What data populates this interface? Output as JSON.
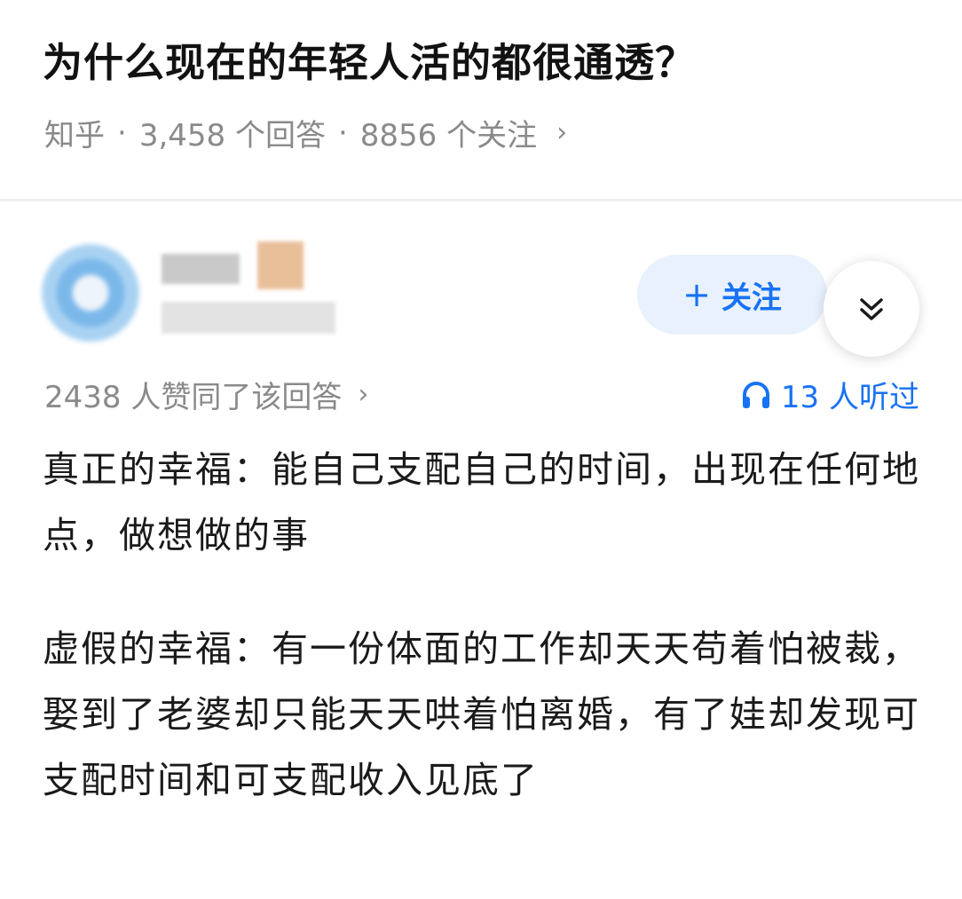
{
  "question": {
    "title": "为什么现在的年轻人活的都很通透？",
    "source": "知乎",
    "answers_count": "3,458 个回答",
    "followers_count": "8856 个关注"
  },
  "author": {
    "follow_label": "关注"
  },
  "answer": {
    "votes_text": "2438 人赞同了该回答",
    "listen_text": "13 人听过",
    "paragraphs": [
      "真正的幸福：能自己支配自己的时间，出现在任何地点，做想做的事",
      "虚假的幸福：有一份体面的工作却天天苟着怕被裁，娶到了老婆却只能天天哄着怕离婚，有了娃却发现可支配时间和可支配收入见底了"
    ]
  },
  "colors": {
    "accent": "#1772f6",
    "secondary_text": "#8a8a8a",
    "follow_bg": "#e8f1fd"
  },
  "icons": {
    "meta_chevron": "chevron-right-icon",
    "collapse": "double-chevron-down-icon",
    "listen": "headphones-icon"
  }
}
